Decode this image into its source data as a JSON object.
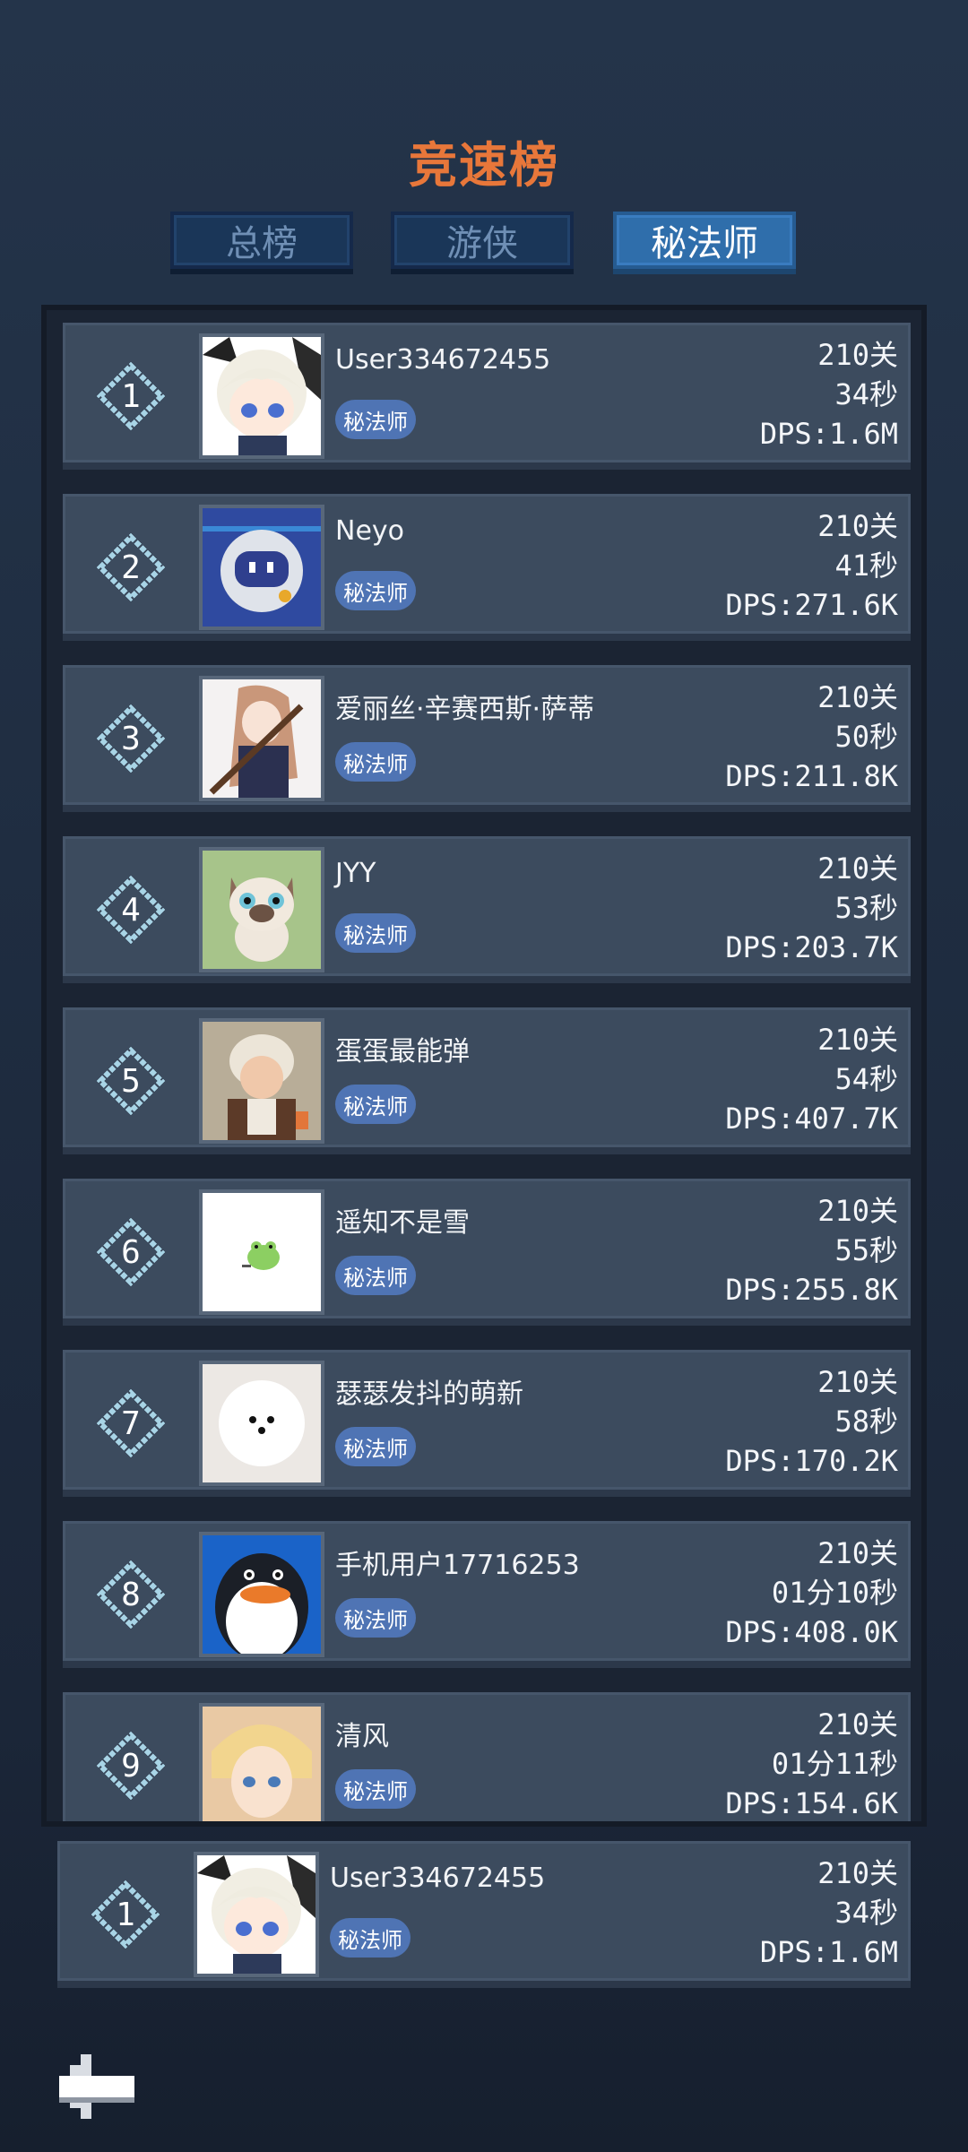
{
  "title": "竞速榜",
  "tabs": [
    {
      "label": "总榜",
      "active": false
    },
    {
      "label": "游侠",
      "active": false
    },
    {
      "label": "秘法师",
      "active": true
    }
  ],
  "entries": [
    {
      "rank": "1",
      "name": "User334672455",
      "badge": "秘法师",
      "level": "210关",
      "time": "34秒",
      "dps": "DPS:1.6M",
      "avatar": "anime-white-hair-avatar"
    },
    {
      "rank": "2",
      "name": "Neyo",
      "badge": "秘法师",
      "level": "210关",
      "time": "41秒",
      "dps": "DPS:271.6K",
      "avatar": "robot-ball-avatar"
    },
    {
      "rank": "3",
      "name": "爱丽丝·辛赛西斯·萨蒂",
      "badge": "秘法师",
      "level": "210关",
      "time": "50秒",
      "dps": "DPS:211.8K",
      "avatar": "anime-girl-rifle-avatar"
    },
    {
      "rank": "4",
      "name": "JYY",
      "badge": "秘法师",
      "level": "210关",
      "time": "53秒",
      "dps": "DPS:203.7K",
      "avatar": "siamese-cat-avatar"
    },
    {
      "rank": "5",
      "name": "蛋蛋最能弹",
      "badge": "秘法师",
      "level": "210关",
      "time": "54秒",
      "dps": "DPS:407.7K",
      "avatar": "baby-photo-avatar"
    },
    {
      "rank": "6",
      "name": "遥知不是雪",
      "badge": "秘法师",
      "level": "210关",
      "time": "55秒",
      "dps": "DPS:255.8K",
      "avatar": "green-frog-sticker-avatar"
    },
    {
      "rank": "7",
      "name": "瑟瑟发抖的萌新",
      "badge": "秘法师",
      "level": "210关",
      "time": "58秒",
      "dps": "DPS:170.2K",
      "avatar": "white-pomeranian-avatar"
    },
    {
      "rank": "8",
      "name": "手机用户17716253",
      "badge": "秘法师",
      "level": "210关",
      "time": "01分10秒",
      "dps": "DPS:408.0K",
      "avatar": "penguin-avatar"
    },
    {
      "rank": "9",
      "name": "清风",
      "badge": "秘法师",
      "level": "210关",
      "time": "01分11秒",
      "dps": "DPS:154.6K",
      "avatar": "anime-blond-boy-avatar"
    }
  ],
  "self_entry": {
    "rank": "1",
    "name": "User334672455",
    "badge": "秘法师",
    "level": "210关",
    "time": "34秒",
    "dps": "DPS:1.6M",
    "avatar": "anime-white-hair-avatar"
  },
  "colors": {
    "title": "#e8773a",
    "badge": "#4f74b4",
    "tab_active": "#2f6eab",
    "tab_inactive": "#1a3658",
    "row": "#3c4b5e",
    "rank_outline": "#a8d4e6"
  },
  "back_icon": "back-arrow-icon"
}
